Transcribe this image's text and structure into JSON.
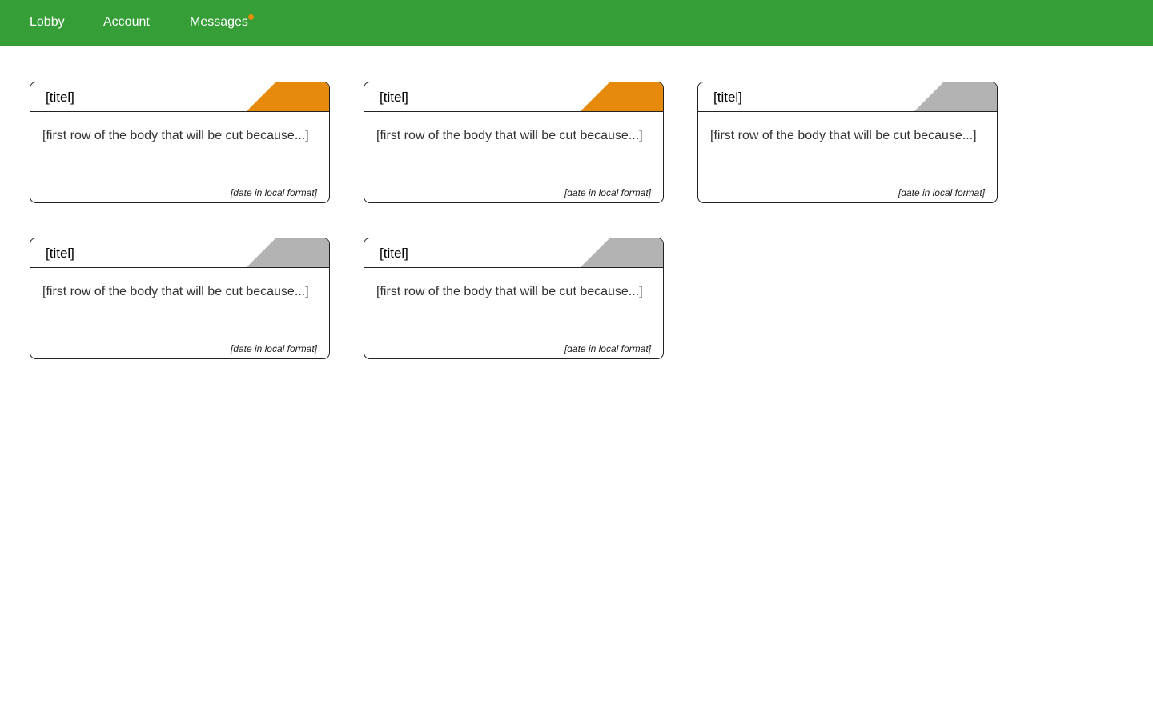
{
  "nav": {
    "lobby": "Lobby",
    "account": "Account",
    "messages": "Messages",
    "notification_color": "#e58a0b"
  },
  "colors": {
    "topbar": "#359e37",
    "flag_orange": "#e58a0b",
    "flag_gray": "#b3b3b3"
  },
  "cards": [
    {
      "title": "[titel]",
      "body": "[first row of the body that will be cut because...]",
      "date": "[date in local format]",
      "flag_color": "#e58a0b"
    },
    {
      "title": "[titel]",
      "body": "[first row of the body that will be cut because...]",
      "date": "[date in local format]",
      "flag_color": "#e58a0b"
    },
    {
      "title": "[titel]",
      "body": "[first row of the body that will be cut because...]",
      "date": "[date in local format]",
      "flag_color": "#b3b3b3"
    },
    {
      "title": "[titel]",
      "body": "[first row of the body that will be cut because...]",
      "date": "[date in local format]",
      "flag_color": "#b3b3b3"
    },
    {
      "title": "[titel]",
      "body": "[first row of the body that will be cut because...]",
      "date": "[date in local format]",
      "flag_color": "#b3b3b3"
    }
  ]
}
